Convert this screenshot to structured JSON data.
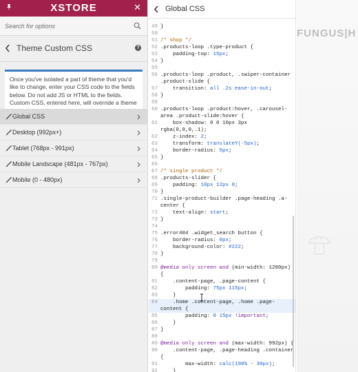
{
  "app": {
    "logo": "XSTORE"
  },
  "search": {
    "placeholder": "Search for options"
  },
  "section": {
    "title": "Theme Custom CSS"
  },
  "notice": {
    "text": "Once you've isolated a part of theme that you'd like to change, enter your CSS code to the fields below. Do not add JS or HTML to the fields. Custom CSS, entered here, will override a theme CSS. In some cases, the !important tag may be needed."
  },
  "menu": {
    "items": [
      {
        "label": "Global CSS",
        "active": true
      },
      {
        "label": "Desktop (992px+)"
      },
      {
        "label": "Tablet (768px - 991px)"
      },
      {
        "label": "Mobile Landscape (481px - 767px)"
      },
      {
        "label": "Mobile (0 - 480px)"
      }
    ]
  },
  "editor": {
    "title": "Global CSS",
    "lines": [
      {
        "n": "49",
        "t": "}"
      },
      {
        "n": "50",
        "t": ""
      },
      {
        "n": "51",
        "t": "/* shop */"
      },
      {
        "n": "52",
        "t": ".products-loop .type-product {"
      },
      {
        "n": "53",
        "t": "    padding-top: 15px;"
      },
      {
        "n": "54",
        "t": "}"
      },
      {
        "n": "55",
        "t": ""
      },
      {
        "n": "56",
        "t": ".products-loop .product, .swiper-container"
      },
      {
        "n": "",
        "t": ".product-slide {"
      },
      {
        "n": "57",
        "t": "    transition: all .2s ease-in-out;"
      },
      {
        "n": "58",
        "t": "}"
      },
      {
        "n": "59",
        "t": ""
      },
      {
        "n": "60",
        "t": ".products-loop .product:hover, .carousel-"
      },
      {
        "n": "",
        "t": "area .product-slide:hover {"
      },
      {
        "n": "61",
        "t": "    box-shadow: 0 0 10px 3px"
      },
      {
        "n": "",
        "t": "rgba(0,0,0,.1);"
      },
      {
        "n": "62",
        "t": "    z-index: 2;"
      },
      {
        "n": "63",
        "t": "    transform: translateY(-5px);"
      },
      {
        "n": "64",
        "t": "    border-radius: 5px;"
      },
      {
        "n": "65",
        "t": "}"
      },
      {
        "n": "66",
        "t": ""
      },
      {
        "n": "67",
        "t": "/* single product */"
      },
      {
        "n": "68",
        "t": ".products-slider {"
      },
      {
        "n": "69",
        "t": "    padding: 10px 12px 0;"
      },
      {
        "n": "70",
        "t": "}"
      },
      {
        "n": "71",
        "t": ".single-product-builder .page-heading .a-"
      },
      {
        "n": "",
        "t": "center {"
      },
      {
        "n": "72",
        "t": "    text-align: start;"
      },
      {
        "n": "73",
        "t": "}"
      },
      {
        "n": "74",
        "t": ""
      },
      {
        "n": "75",
        "t": ".error404 .widget_search button {"
      },
      {
        "n": "76",
        "t": "    border-radius: 0px;"
      },
      {
        "n": "77",
        "t": "    background-color: #222;"
      },
      {
        "n": "78",
        "t": "}"
      },
      {
        "n": "79",
        "t": ""
      },
      {
        "n": "80",
        "t": "@media only screen and (min-width: 1200px)"
      },
      {
        "n": "",
        "t": "{"
      },
      {
        "n": "81",
        "t": "    .content-page, .page-content {"
      },
      {
        "n": "82",
        "t": "        padding: 75px 115px;"
      },
      {
        "n": "83",
        "t": "    }"
      },
      {
        "n": "84",
        "t": "    .home .content-page, .home .page-"
      },
      {
        "n": "",
        "t": "content {"
      },
      {
        "n": "85",
        "t": "        padding: 0 15px !important;"
      },
      {
        "n": "86",
        "t": "    }"
      },
      {
        "n": "87",
        "t": "}"
      },
      {
        "n": "88",
        "t": ""
      },
      {
        "n": "89",
        "t": "@media only screen and (max-width: 992px) {"
      },
      {
        "n": "90",
        "t": "    .content-page, .page-heading .container"
      },
      {
        "n": "",
        "t": "{"
      },
      {
        "n": "91",
        "t": "        max-width: calc(100% - 30px);"
      },
      {
        "n": "92",
        "t": "    }"
      }
    ]
  },
  "preview": {
    "brand": "FUNGUS|H"
  },
  "colors": {
    "brand": "#a1204c",
    "notice_border": "#3b7bbf",
    "highlight": "#e7f0fb"
  }
}
